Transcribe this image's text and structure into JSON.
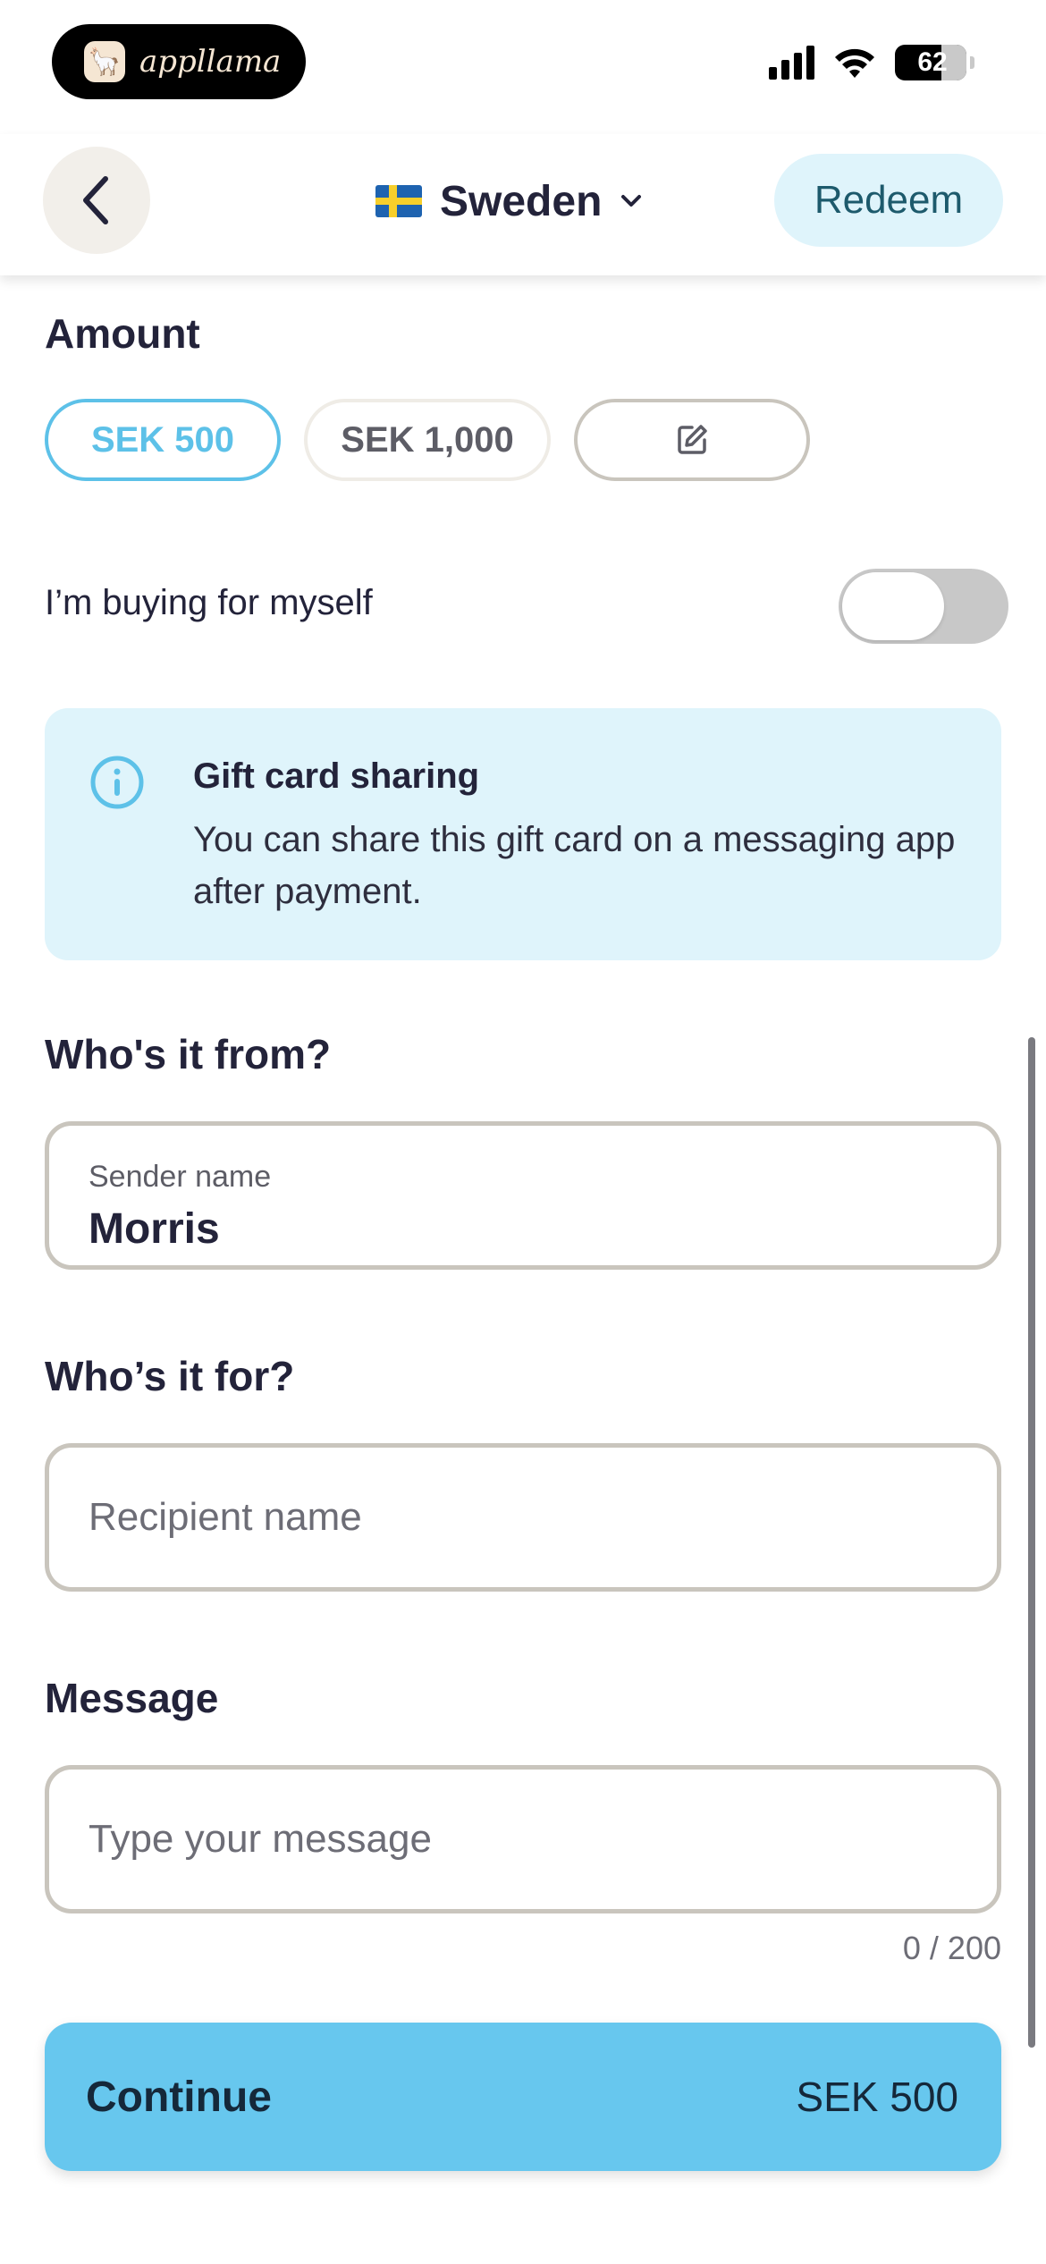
{
  "status_bar": {
    "app_name": "appllama",
    "battery": "62",
    "icons": [
      "signal-icon",
      "wifi-icon",
      "battery-icon"
    ]
  },
  "header": {
    "back_icon": "chevron-left-icon",
    "country": "Sweden",
    "flag": "sweden-flag-icon",
    "dropdown_icon": "chevron-down-icon",
    "redeem_label": "Redeem"
  },
  "amount": {
    "label": "Amount",
    "options": [
      "SEK 500",
      "SEK 1,000"
    ],
    "selected": "SEK 500",
    "custom_icon": "edit-icon"
  },
  "self_purchase": {
    "label": "I’m buying for myself",
    "enabled": false
  },
  "info": {
    "icon": "info-icon",
    "title": "Gift card sharing",
    "text": "You can share this gift card on a messaging app after payment."
  },
  "sender": {
    "heading": "Who's it from?",
    "label": "Sender name",
    "value": "Morris"
  },
  "recipient": {
    "heading": "Who’s it for?",
    "placeholder": "Recipient name"
  },
  "message": {
    "heading": "Message",
    "placeholder": "Type your message",
    "counter": "0 / 200"
  },
  "continue": {
    "label": "Continue",
    "price": "SEK 500"
  },
  "colors": {
    "accent": "#67c7ee",
    "accent_light": "#dff4fb",
    "text": "#23233a",
    "border": "#c9c5bd"
  }
}
